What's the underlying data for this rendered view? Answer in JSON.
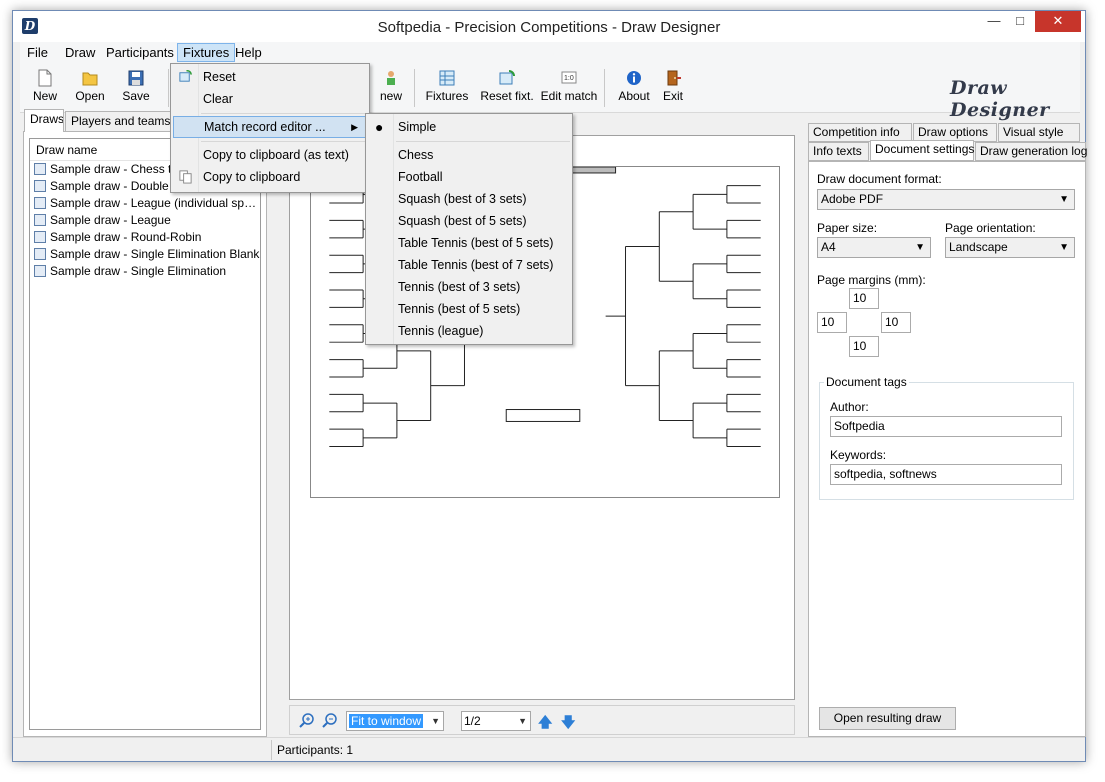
{
  "window": {
    "title": "Softpedia - Precision Competitions - Draw Designer"
  },
  "menubar": [
    "File",
    "Draw",
    "Participants",
    "Fixtures",
    "Help"
  ],
  "toolbar": {
    "new_label": "New",
    "open_label": "Open",
    "save_label": "Save",
    "new2_label": "new",
    "fixtures_label": "Fixtures",
    "reset_fixt_label": "Reset fixt.",
    "edit_match_label": "Edit match",
    "about_label": "About",
    "exit_label": "Exit",
    "brand": "Draw Designer"
  },
  "left_tabs": [
    "Draws",
    "Players and teams d"
  ],
  "draws_list": {
    "header": "Draw name",
    "rows": [
      "Sample draw - Chess tou",
      "Sample draw - Double Elimination Blank",
      "Sample draw - League (individual sp…",
      "Sample draw - League",
      "Sample draw - Round-Robin",
      "Sample draw - Single Elimination Blank",
      "Sample draw - Single Elimination"
    ]
  },
  "fixtures_menu": {
    "items": [
      "Reset",
      "Clear",
      "Match record editor ...",
      "Copy to clipboard (as text)",
      "Copy to clipboard"
    ]
  },
  "match_editor_submenu": {
    "items": [
      "Simple",
      "Chess",
      "Football",
      "Squash (best of 3 sets)",
      "Squash (best of 5 sets)",
      "Table Tennis (best of 5 sets)",
      "Table Tennis (best of 7 sets)",
      "Tennis (best of 3 sets)",
      "Tennis (best of 5 sets)",
      "Tennis (league)"
    ],
    "selected": "Simple"
  },
  "preview_toolbar": {
    "zoom_mode": "Fit to window",
    "page": "1/2"
  },
  "right_tabs": {
    "row1": [
      "Competition info",
      "Draw options",
      "Visual style"
    ],
    "row2": [
      "Info texts",
      "Document settings",
      "Draw generation log"
    ]
  },
  "doc_settings": {
    "format_label": "Draw document format:",
    "format_value": "Adobe PDF",
    "paper_label": "Paper size:",
    "paper_value": "A4",
    "orientation_label": "Page orientation:",
    "orientation_value": "Landscape",
    "margins_label": "Page margins (mm):",
    "margin_top": "10",
    "margin_left": "10",
    "margin_right": "10",
    "margin_bottom": "10",
    "tags_title": "Document tags",
    "author_label": "Author:",
    "author_value": "Softpedia",
    "keywords_label": "Keywords:",
    "keywords_value": "softpedia, softnews",
    "open_button": "Open resulting draw"
  },
  "status": {
    "participants": "Participants: 1"
  }
}
